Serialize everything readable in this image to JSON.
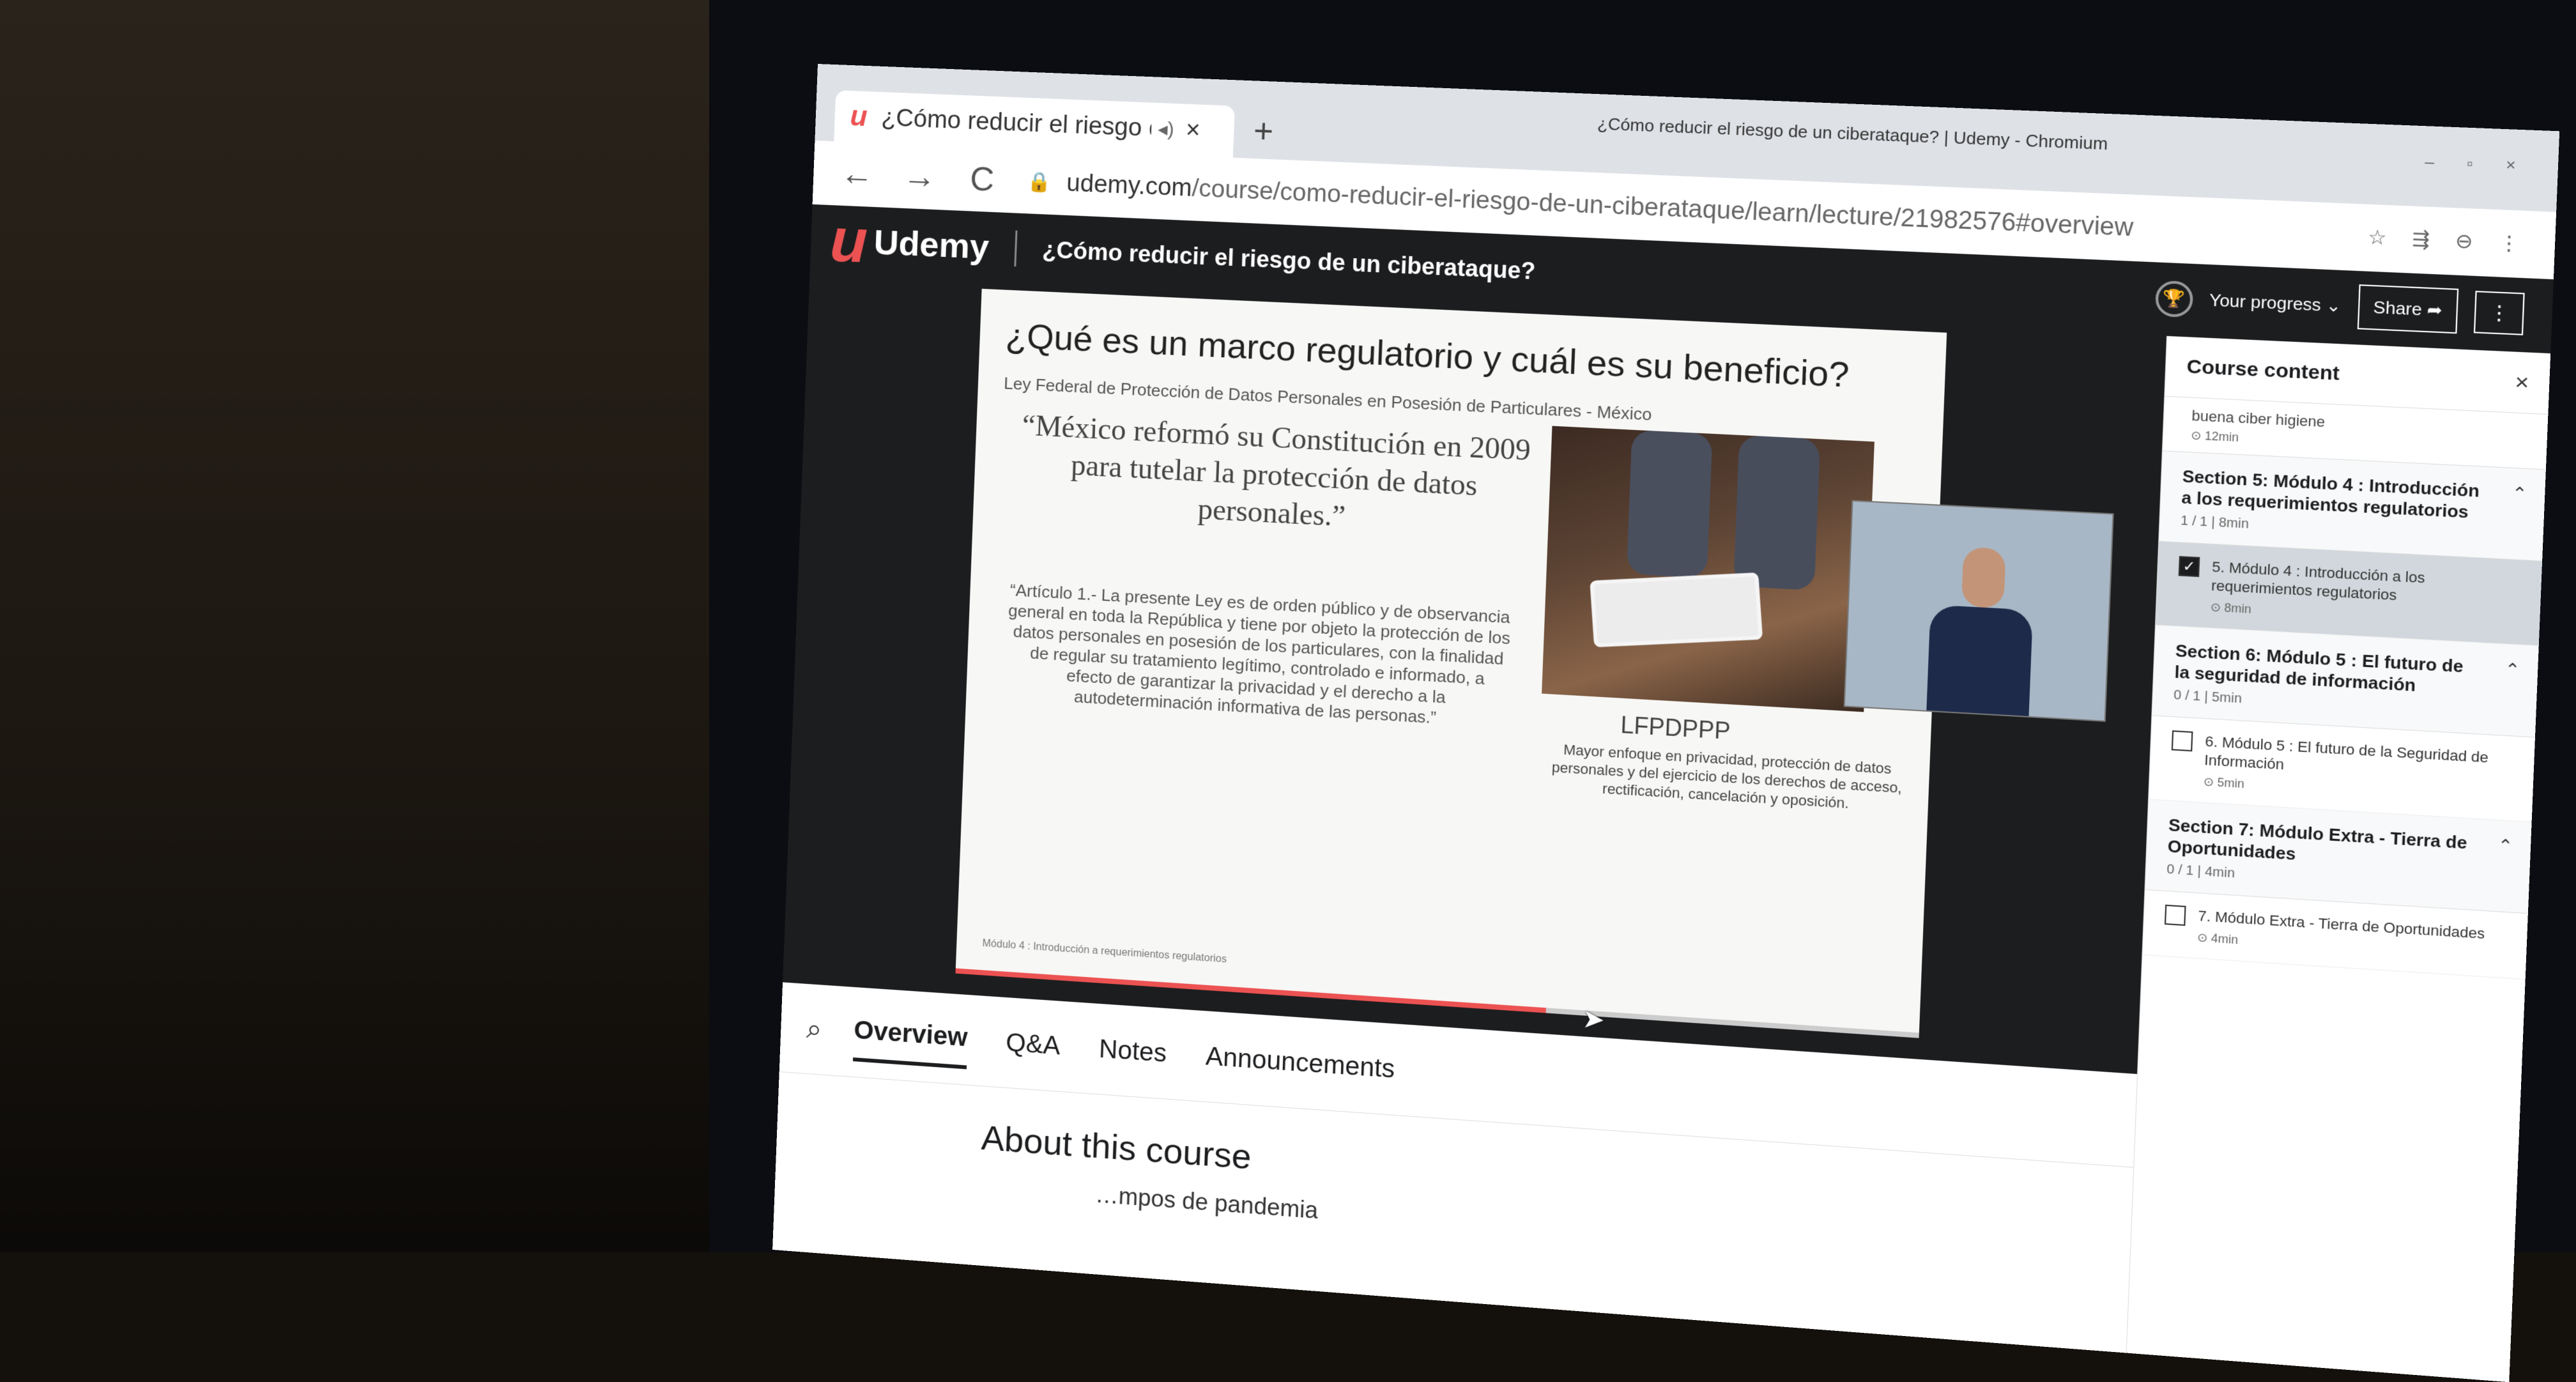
{
  "browser": {
    "tab_favicon": "u",
    "tab_title": "¿Cómo reducir el riesgo de un ciberataque?",
    "tab_audio_icon": "speaker-icon",
    "tab_close": "×",
    "new_tab": "+",
    "window_title": "¿Cómo reducir el riesgo de un ciberataque? | Udemy - Chromium",
    "url_domain": "udemy.com",
    "url_path": "/course/como-reducir-el-riesgo-de-un-ciberataque/learn/lecture/21982576#overview",
    "back": "←",
    "forward": "→",
    "reload": "C",
    "lock": "🔒",
    "right_icons": "☆ ⇶ ⊖ ⋮",
    "window_controls": "– ▫ ×"
  },
  "header": {
    "logo_mark": "u",
    "logo_text": "Udemy",
    "course_title": "¿Cómo reducir el riesgo de un ciberataque?",
    "progress_label": "Your progress ⌄",
    "progress_icon": "🏆",
    "share_label": "Share ➦",
    "more_label": "⋮"
  },
  "slide": {
    "title": "¿Qué es un marco regulatorio y cuál es su beneficio?",
    "subtitle": "Ley Federal de Protección de Datos Personales en Posesión de Particulares - México",
    "quote": "“México reformó su Constitución en 2009 para tutelar la protección de datos personales.”",
    "article": "“Artículo 1.- La presente Ley es de orden público y de observancia general en toda la República y tiene por objeto la protección de los datos personales en posesión de los particulares, con la finalidad de regular su tratamiento legítimo, controlado e informado, a efecto de garantizar la privacidad y el derecho a la autodeterminación informativa de las personas.”",
    "image_label": "LFPDPPP",
    "image_desc": "Mayor enfoque en privacidad, protección de datos personales y del ejercicio de los derechos de acceso, rectificación, cancelación y oposición.",
    "footer": "Módulo 4 : Introducción a requerimientos regulatorios",
    "progress_fraction": 0.62
  },
  "tabs": {
    "search_icon": "⌕",
    "items": [
      "Overview",
      "Q&A",
      "Notes",
      "Announcements"
    ],
    "active": "Overview"
  },
  "overview": {
    "heading": "About this course",
    "subtitle": "…mpos de pandemia"
  },
  "sidebar": {
    "title": "Course content",
    "close": "×",
    "prev_item": "buena ciber higiene",
    "prev_meta": "⊙ 12min",
    "sections": [
      {
        "title": "Section 5: Módulo 4 : Introducción a los requerimientos regulatorios",
        "meta": "1 / 1 | 8min",
        "chevron": "⌃",
        "lecture": "5. Módulo 4 : Introducción a los requerimientos regulatorios",
        "lecture_meta": "⊙ 8min",
        "checked": "✓"
      },
      {
        "title": "Section 6: Módulo 5 : El futuro de la seguridad de información",
        "meta": "0 / 1 | 5min",
        "chevron": "⌃",
        "lecture": "6. Módulo 5 : El futuro de la Seguridad de Información",
        "lecture_meta": "⊙ 5min",
        "checked": ""
      },
      {
        "title": "Section 7: Módulo Extra - Tierra de Oportunidades",
        "meta": "0 / 1 | 4min",
        "chevron": "⌃",
        "lecture": "7. Módulo Extra - Tierra de Oportunidades",
        "lecture_meta": "⊙ 4min",
        "checked": ""
      }
    ]
  },
  "colors": {
    "udemy_red": "#ec5252",
    "header_dark": "#1c1d1f"
  }
}
